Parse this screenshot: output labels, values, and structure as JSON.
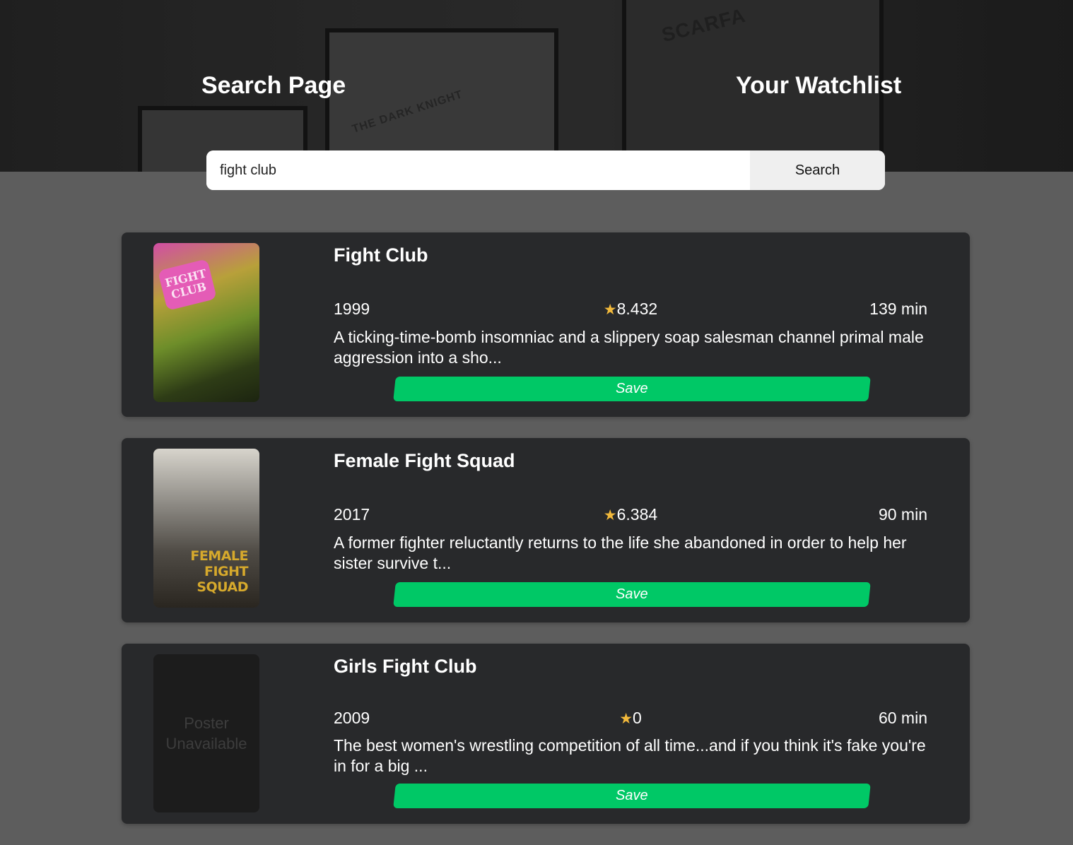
{
  "nav": {
    "search_page": "Search Page",
    "watchlist": "Your Watchlist"
  },
  "hero_posters": {
    "left_text": "THE DARK KNIGHT",
    "right_text": "SCARFA"
  },
  "search": {
    "value": "fight club",
    "button_label": "Search"
  },
  "results": [
    {
      "title": "Fight Club",
      "year": "1999",
      "rating": "8.432",
      "runtime": "139 min",
      "overview": "A ticking-time-bomb insomniac and a slippery soap salesman channel primal male aggression into a sho...",
      "save_label": "Save",
      "poster_text": "FIGHT CLUB"
    },
    {
      "title": "Female Fight Squad",
      "year": "2017",
      "rating": "6.384",
      "runtime": "90 min",
      "overview": "A former fighter reluctantly returns to the life she abandoned in order to help her sister survive t...",
      "save_label": "Save",
      "poster_text": "FEMALE FIGHT SQUAD"
    },
    {
      "title": "Girls Fight Club",
      "year": "2009",
      "rating": "0",
      "runtime": "60 min",
      "overview": "The best women's wrestling competition of all time...and if you think it's fake you're in for a big ...",
      "save_label": "Save",
      "poster_text": "Poster Unavailable"
    }
  ],
  "colors": {
    "accent_green": "#00c866",
    "star": "#f2b93b",
    "card_bg": "#28292b",
    "page_bg": "#5d5d5d"
  },
  "icons": {
    "rating": "star-icon"
  }
}
